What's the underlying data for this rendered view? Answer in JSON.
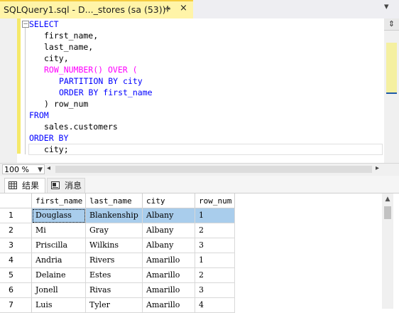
{
  "tab": {
    "title": "SQLQuery1.sql - D..._stores (sa (53))*",
    "pin_icon": "⊹",
    "close_icon": "×",
    "overflow_icon": "▾"
  },
  "editor": {
    "lines": [
      [
        "SELECT"
      ],
      [
        "first_name,"
      ],
      [
        "last_name,"
      ],
      [
        "city,"
      ],
      [
        "ROW_NUMBER() OVER ("
      ],
      [
        "PARTITION BY city"
      ],
      [
        "ORDER BY first_name"
      ],
      [
        ") row_num"
      ],
      [
        "FROM"
      ],
      [
        "sales.customers"
      ],
      [
        "ORDER BY"
      ],
      [
        "city;"
      ]
    ],
    "split_icon": "⇕"
  },
  "zoom": {
    "value": "100 %"
  },
  "results_tabs": [
    {
      "label": "结果"
    },
    {
      "label": "消息"
    }
  ],
  "grid": {
    "columns": [
      "first_name",
      "last_name",
      "city",
      "row_num"
    ],
    "rows": [
      {
        "n": "1",
        "cells": [
          "Douglass",
          "Blankenship",
          "Albany",
          "1"
        ]
      },
      {
        "n": "2",
        "cells": [
          "Mi",
          "Gray",
          "Albany",
          "2"
        ]
      },
      {
        "n": "3",
        "cells": [
          "Priscilla",
          "Wilkins",
          "Albany",
          "3"
        ]
      },
      {
        "n": "4",
        "cells": [
          "Andria",
          "Rivers",
          "Amarillo",
          "1"
        ]
      },
      {
        "n": "5",
        "cells": [
          "Delaine",
          "Estes",
          "Amarillo",
          "2"
        ]
      },
      {
        "n": "6",
        "cells": [
          "Jonell",
          "Rivas",
          "Amarillo",
          "3"
        ]
      },
      {
        "n": "7",
        "cells": [
          "Luis",
          "Tyler",
          "Amarillo",
          "4"
        ]
      }
    ]
  },
  "colors": {
    "keyword": "#0000ff",
    "function": "#ff00ff",
    "tab_active": "#fff4a8",
    "selection": "#a9cdec"
  }
}
